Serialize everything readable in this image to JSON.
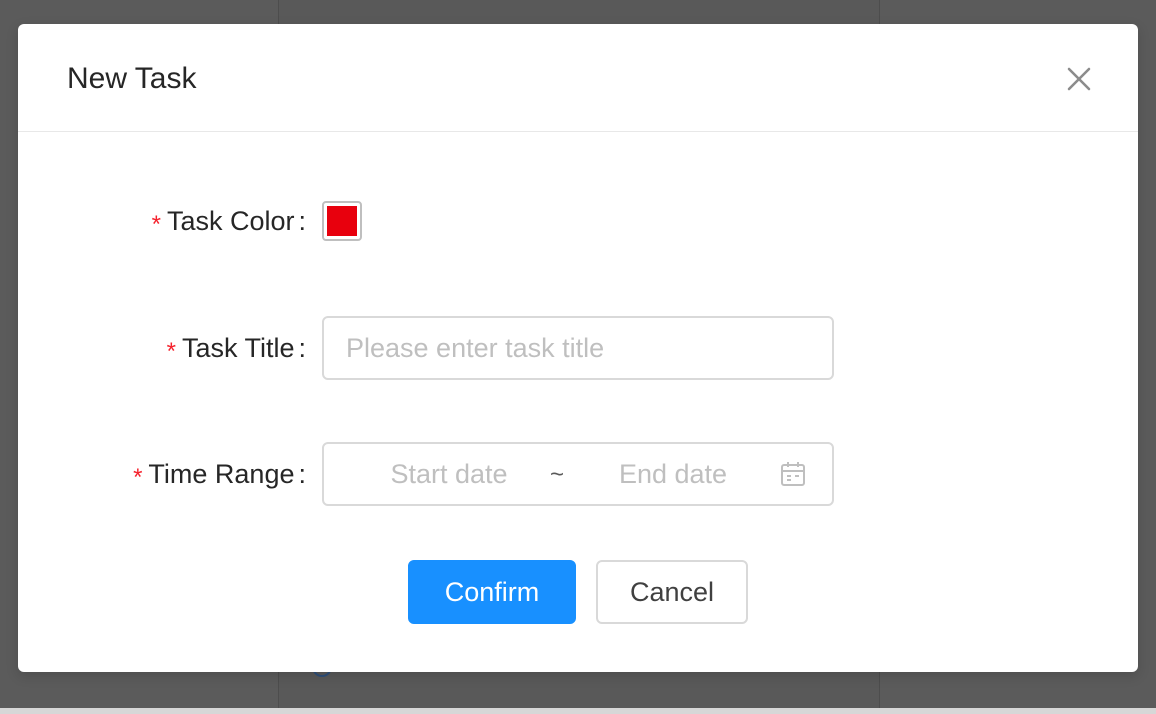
{
  "modal": {
    "title": "New Task",
    "close_icon": "close-icon"
  },
  "form": {
    "required_mark": "*",
    "colon": ":",
    "task_color": {
      "label": "Task Color",
      "value": "#e8000d"
    },
    "task_title": {
      "label": "Task Title",
      "placeholder": "Please enter task title",
      "value": ""
    },
    "time_range": {
      "label": "Time Range",
      "start_placeholder": "Start date",
      "separator": "~",
      "end_placeholder": "End date",
      "icon": "calendar-icon"
    }
  },
  "actions": {
    "confirm_label": "Confirm",
    "cancel_label": "Cancel"
  },
  "colors": {
    "primary": "#1890ff",
    "required": "#f5222d",
    "overlay": "#5b5b5b"
  }
}
